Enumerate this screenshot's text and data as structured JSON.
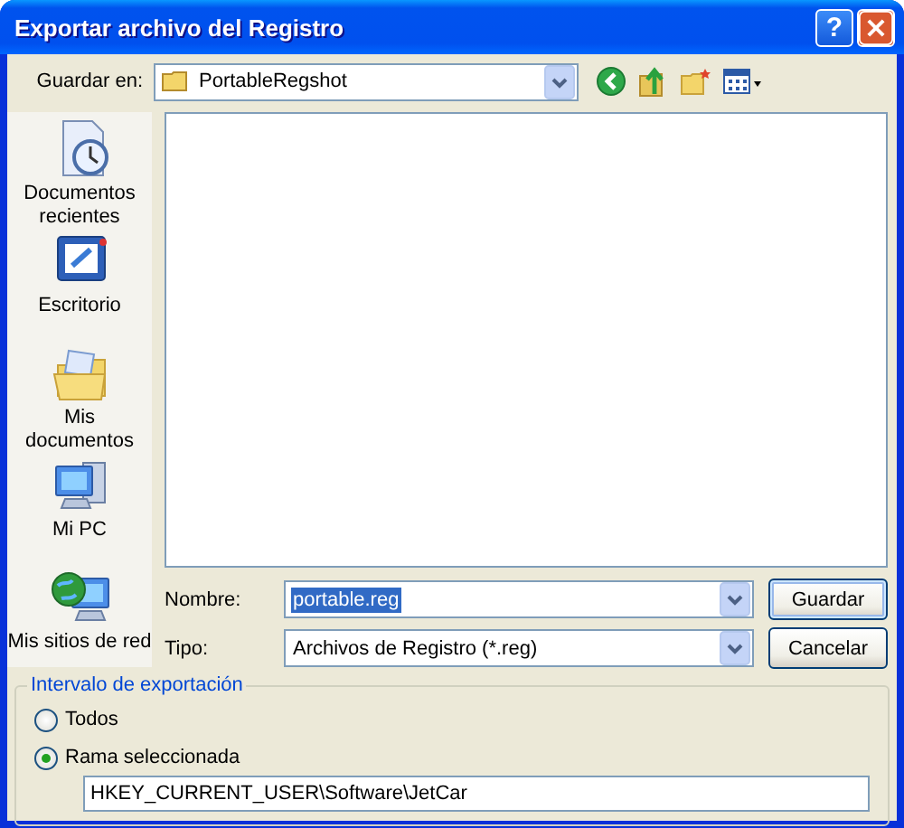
{
  "window": {
    "title": "Exportar archivo del Registro",
    "help_button": "?"
  },
  "save_in": {
    "label": "Guardar en:",
    "value": "PortableRegshot"
  },
  "places": [
    {
      "label": "Documentos recientes",
      "kind": "recent"
    },
    {
      "label": "Escritorio",
      "kind": "desktop"
    },
    {
      "label": "Mis documentos",
      "kind": "documents"
    },
    {
      "label": "Mi PC",
      "kind": "computer"
    },
    {
      "label": "Mis sitios de red",
      "kind": "network"
    }
  ],
  "file_name": {
    "label": "Nombre:",
    "value": "portable.reg",
    "selected": true
  },
  "file_type": {
    "label": "Tipo:",
    "value": "Archivos de Registro (*.reg)"
  },
  "buttons": [
    {
      "label": "Guardar",
      "default": true
    },
    {
      "label": "Cancelar",
      "default": false
    }
  ],
  "export_range": {
    "title": "Intervalo de exportación",
    "options": [
      {
        "label": "Todos",
        "selected": false
      },
      {
        "label": "Rama seleccionada",
        "selected": true
      }
    ],
    "branch": "HKEY_CURRENT_USER\\Software\\JetCar"
  }
}
